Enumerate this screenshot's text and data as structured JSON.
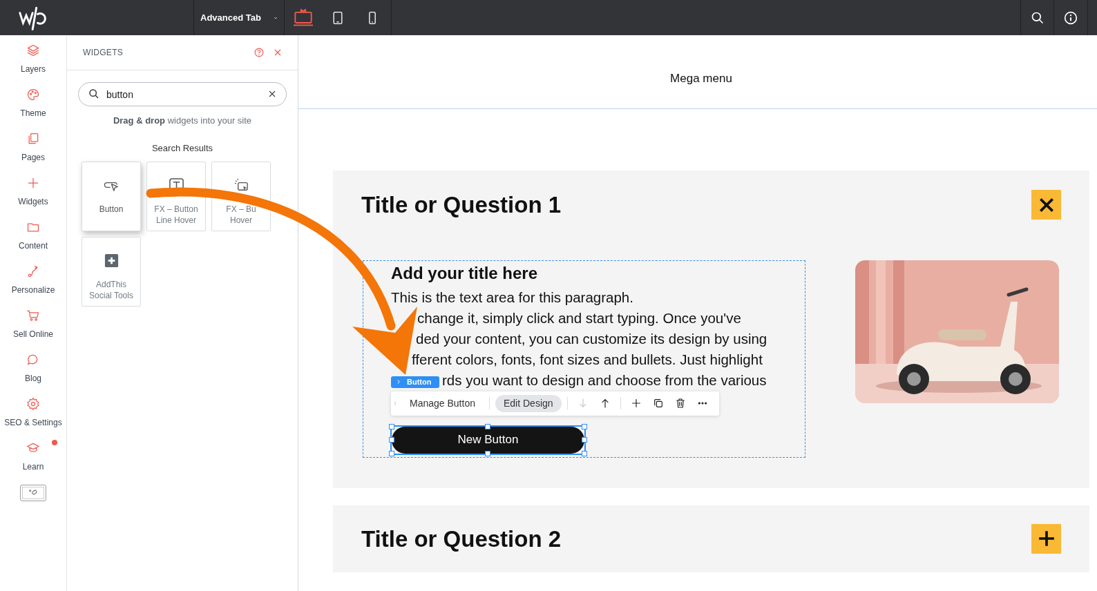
{
  "topbar": {
    "page_selector": "Advanced Tab",
    "devices": [
      {
        "kind": "desktop",
        "selected": true
      },
      {
        "kind": "tablet",
        "selected": false
      },
      {
        "kind": "mobile",
        "selected": false
      }
    ]
  },
  "sidebar": {
    "items": [
      {
        "label": "Layers",
        "notification": false
      },
      {
        "label": "Theme",
        "notification": false
      },
      {
        "label": "Pages",
        "notification": false
      },
      {
        "label": "Widgets",
        "notification": false
      },
      {
        "label": "Content",
        "notification": false
      },
      {
        "label": "Personalize",
        "notification": false
      },
      {
        "label": "Sell Online",
        "notification": false
      },
      {
        "label": "Blog",
        "notification": false
      },
      {
        "label": "SEO & Settings",
        "notification": false
      },
      {
        "label": "Learn",
        "notification": true
      }
    ]
  },
  "widgets_panel": {
    "title": "WIDGETS",
    "search": {
      "value": "button"
    },
    "hint": "**Drag & drop** widgets into your site",
    "results_heading": "Search Results",
    "results": [
      {
        "lines": [
          "Button"
        ],
        "highlighted": true
      },
      {
        "lines": [
          "FX – Button",
          "Line Hover"
        ],
        "highlighted": false
      },
      {
        "lines": [
          "FX – Bu",
          "Hover"
        ],
        "highlighted": false
      },
      {
        "lines": [
          "AddThis",
          "Social Tools"
        ],
        "highlighted": false
      }
    ]
  },
  "canvas": {
    "header": "Mega menu",
    "faq": [
      {
        "title": "Title or Question 1",
        "expanded": true,
        "content": {
          "heading": "Add your title here",
          "paragraph_lines": [
            "This is the text area for this paragraph.",
            "change it, simply click and start typing. Once you've",
            "ded your content, you can customize its design by using",
            "fferent colors, fonts, font sizes and bullets. Just highlight",
            "rds you want to design and choose from the various"
          ],
          "selected_label": "Button",
          "toolbar": {
            "manage": "Manage Button",
            "edit": "Edit Design",
            "actions": [
              {
                "kind": "down",
                "disabled": true
              },
              {
                "kind": "up",
                "disabled": false
              },
              {
                "kind": "add",
                "disabled": false
              },
              {
                "kind": "copy",
                "disabled": false
              },
              {
                "kind": "delete",
                "disabled": false
              },
              {
                "kind": "more",
                "disabled": false
              }
            ]
          },
          "button": "New Button",
          "image": {
            "kind": "picture"
          }
        }
      },
      {
        "title": "Title or Question 2",
        "expanded": false
      }
    ]
  }
}
